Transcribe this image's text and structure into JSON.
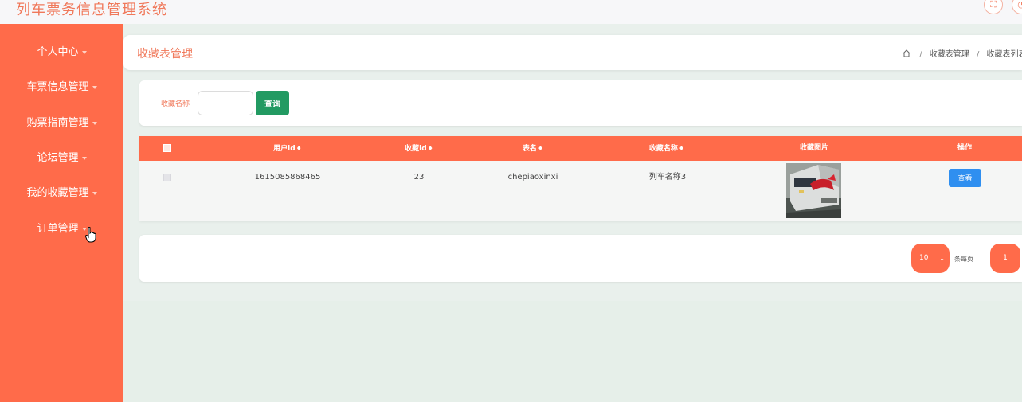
{
  "app": {
    "title": "列车票务信息管理系统"
  },
  "top_icons": [
    {
      "icon": "fullscreen-icon"
    },
    {
      "icon": "user-icon"
    }
  ],
  "sidebar": {
    "items": [
      {
        "label": "个人中心"
      },
      {
        "label": "车票信息管理"
      },
      {
        "label": "购票指南管理"
      },
      {
        "label": "论坛管理"
      },
      {
        "label": "我的收藏管理"
      },
      {
        "label": "订单管理"
      }
    ]
  },
  "header": {
    "title": "收藏表管理",
    "breadcrumb": [
      "收藏表管理",
      "收藏表列表"
    ]
  },
  "search": {
    "label": "收藏名称",
    "value": "",
    "placeholder": "",
    "button": "查询"
  },
  "table": {
    "columns": [
      "用户id",
      "收藏id",
      "表名",
      "收藏名称",
      "收藏图片",
      "操作"
    ],
    "sort_glyph": "♦",
    "rows": [
      {
        "user_id": "1615085868465",
        "fav_id": "23",
        "table_name": "chepiaoxinxi",
        "fav_name": "列车名称3",
        "action": "查看"
      }
    ]
  },
  "pager": {
    "page_size": "10",
    "per_page_label": "条每页",
    "current_page": "1"
  },
  "colors": {
    "accent": "#ff6b4a",
    "title": "#f0785a",
    "search_button": "#229a62",
    "view_button": "#2f8ff0"
  }
}
